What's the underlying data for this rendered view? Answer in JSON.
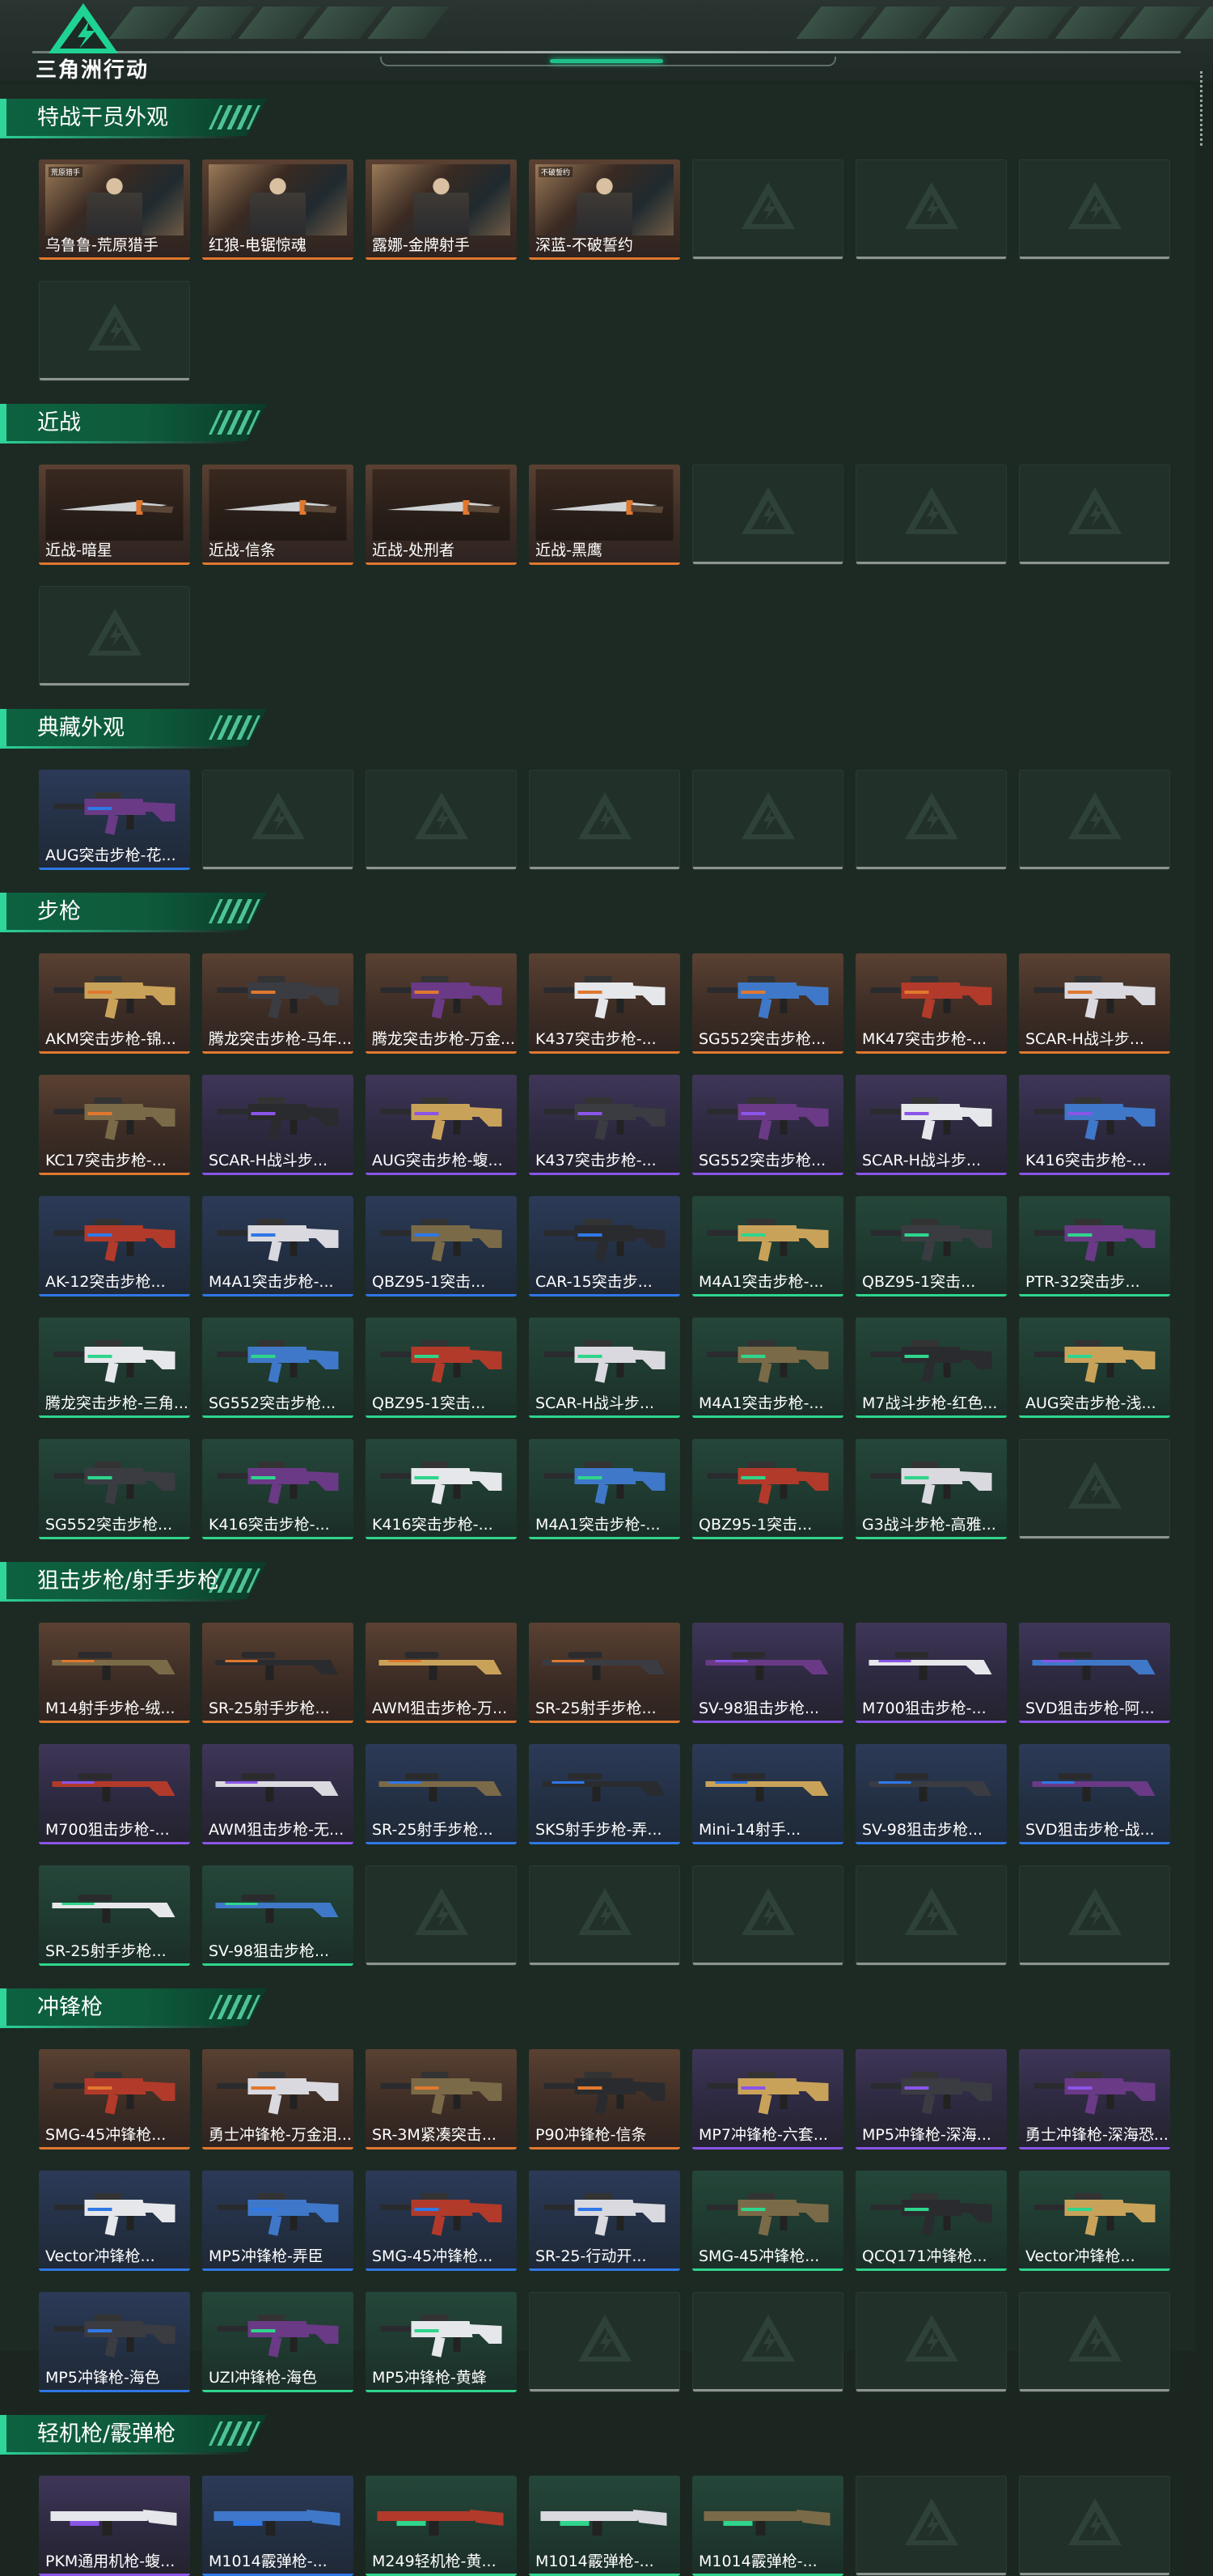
{
  "brand": {
    "name": "三角洲行动"
  },
  "colors": {
    "orange": "#e0782f",
    "purple": "#8a55e8",
    "blue": "#2f78e6",
    "green": "#2fd58c",
    "accent": "#2bd39a"
  },
  "sections": [
    {
      "title": "特战干员外观",
      "items": [
        {
          "name": "乌鲁鲁-荒原猎手",
          "quality": "orange",
          "icon": "operator-skin",
          "tag": "荒原猎手"
        },
        {
          "name": "红狼-电锯惊魂",
          "quality": "orange",
          "icon": "operator-skin"
        },
        {
          "name": "露娜-金牌射手",
          "quality": "orange",
          "icon": "operator-skin"
        },
        {
          "name": "深蓝-不破誓约",
          "quality": "orange",
          "icon": "operator-skin",
          "tag": "不破誓约"
        }
      ],
      "empty": 4
    },
    {
      "title": "近战",
      "items": [
        {
          "name": "近战-暗星",
          "quality": "orange",
          "icon": "knife"
        },
        {
          "name": "近战-信条",
          "quality": "orange",
          "icon": "karambit"
        },
        {
          "name": "近战-处刑者",
          "quality": "orange",
          "icon": "serrated-knife"
        },
        {
          "name": "近战-黑鹰",
          "quality": "orange",
          "icon": "knife"
        }
      ],
      "empty": 4
    },
    {
      "title": "典藏外观",
      "items": [
        {
          "name": "AUG突击步枪-花...",
          "quality": "blue",
          "icon": "rifle"
        }
      ],
      "empty": 6
    },
    {
      "title": "步枪",
      "items": [
        {
          "name": "AKM突击步枪-锦...",
          "quality": "orange",
          "icon": "rifle"
        },
        {
          "name": "腾龙突击步枪-马年...",
          "quality": "orange",
          "icon": "rifle"
        },
        {
          "name": "腾龙突击步枪-万金...",
          "quality": "orange",
          "icon": "rifle"
        },
        {
          "name": "K437突击步枪-...",
          "quality": "orange",
          "icon": "rifle"
        },
        {
          "name": "SG552突击步枪...",
          "quality": "orange",
          "icon": "rifle"
        },
        {
          "name": "MK47突击步枪-...",
          "quality": "orange",
          "icon": "rifle"
        },
        {
          "name": "SCAR-H战斗步...",
          "quality": "orange",
          "icon": "rifle"
        },
        {
          "name": "KC17突击步枪-...",
          "quality": "orange",
          "icon": "rifle"
        },
        {
          "name": "SCAR-H战斗步...",
          "quality": "purple",
          "icon": "rifle"
        },
        {
          "name": "AUG突击步枪-蝮...",
          "quality": "purple",
          "icon": "rifle"
        },
        {
          "name": "K437突击步枪-...",
          "quality": "purple",
          "icon": "rifle"
        },
        {
          "name": "SG552突击步枪...",
          "quality": "purple",
          "icon": "rifle"
        },
        {
          "name": "SCAR-H战斗步...",
          "quality": "purple",
          "icon": "rifle"
        },
        {
          "name": "K416突击步枪-...",
          "quality": "purple",
          "icon": "rifle"
        },
        {
          "name": "AK-12突击步枪...",
          "quality": "blue",
          "icon": "rifle"
        },
        {
          "name": "M4A1突击步枪-...",
          "quality": "blue",
          "icon": "rifle"
        },
        {
          "name": "QBZ95-1突击...",
          "quality": "blue",
          "icon": "rifle"
        },
        {
          "name": "CAR-15突击步...",
          "quality": "blue",
          "icon": "rifle"
        },
        {
          "name": "M4A1突击步枪-...",
          "quality": "green",
          "icon": "rifle"
        },
        {
          "name": "QBZ95-1突击...",
          "quality": "green",
          "icon": "rifle"
        },
        {
          "name": "PTR-32突击步...",
          "quality": "green",
          "icon": "rifle"
        },
        {
          "name": "腾龙突击步枪-三角...",
          "quality": "green",
          "icon": "rifle"
        },
        {
          "name": "SG552突击步枪...",
          "quality": "green",
          "icon": "rifle"
        },
        {
          "name": "QBZ95-1突击...",
          "quality": "green",
          "icon": "rifle"
        },
        {
          "name": "SCAR-H战斗步...",
          "quality": "green",
          "icon": "rifle"
        },
        {
          "name": "M4A1突击步枪-...",
          "quality": "green",
          "icon": "rifle"
        },
        {
          "name": "M7战斗步枪-红色...",
          "quality": "green",
          "icon": "rifle"
        },
        {
          "name": "AUG突击步枪-浅...",
          "quality": "green",
          "icon": "rifle"
        },
        {
          "name": "SG552突击步枪...",
          "quality": "green",
          "icon": "rifle"
        },
        {
          "name": "K416突击步枪-...",
          "quality": "green",
          "icon": "rifle"
        },
        {
          "name": "K416突击步枪-...",
          "quality": "green",
          "icon": "rifle"
        },
        {
          "name": "M4A1突击步枪-...",
          "quality": "green",
          "icon": "rifle"
        },
        {
          "name": "QBZ95-1突击...",
          "quality": "green",
          "icon": "rifle"
        },
        {
          "name": "G3战斗步枪-高雅...",
          "quality": "green",
          "icon": "rifle"
        }
      ],
      "empty": 1
    },
    {
      "title": "狙击步枪/射手步枪",
      "items": [
        {
          "name": "M14射手步枪-绒...",
          "quality": "orange",
          "icon": "sniper"
        },
        {
          "name": "SR-25射手步枪...",
          "quality": "orange",
          "icon": "sniper"
        },
        {
          "name": "AWM狙击步枪-万...",
          "quality": "orange",
          "icon": "sniper"
        },
        {
          "name": "SR-25射手步枪...",
          "quality": "orange",
          "icon": "sniper"
        },
        {
          "name": "SV-98狙击步枪...",
          "quality": "purple",
          "icon": "sniper"
        },
        {
          "name": "M700狙击步枪-...",
          "quality": "purple",
          "icon": "sniper"
        },
        {
          "name": "SVD狙击步枪-阿...",
          "quality": "purple",
          "icon": "sniper"
        },
        {
          "name": "M700狙击步枪-...",
          "quality": "purple",
          "icon": "sniper"
        },
        {
          "name": "AWM狙击步枪-无...",
          "quality": "purple",
          "icon": "sniper"
        },
        {
          "name": "SR-25射手步枪...",
          "quality": "blue",
          "icon": "sniper"
        },
        {
          "name": "SKS射手步枪-弄...",
          "quality": "blue",
          "icon": "sniper"
        },
        {
          "name": "Mini-14射手...",
          "quality": "blue",
          "icon": "sniper"
        },
        {
          "name": "SV-98狙击步枪...",
          "quality": "blue",
          "icon": "sniper"
        },
        {
          "name": "SVD狙击步枪-战...",
          "quality": "blue",
          "icon": "sniper"
        },
        {
          "name": "SR-25射手步枪...",
          "quality": "green",
          "icon": "sniper"
        },
        {
          "name": "SV-98狙击步枪...",
          "quality": "green",
          "icon": "sniper"
        }
      ],
      "empty": 5
    },
    {
      "title": "冲锋枪",
      "items": [
        {
          "name": "SMG-45冲锋枪...",
          "quality": "orange",
          "icon": "smg"
        },
        {
          "name": "勇士冲锋枪-万金泪...",
          "quality": "orange",
          "icon": "smg"
        },
        {
          "name": "SR-3M紧凑突击...",
          "quality": "orange",
          "icon": "smg"
        },
        {
          "name": "P90冲锋枪-信条",
          "quality": "orange",
          "icon": "smg"
        },
        {
          "name": "MP7冲锋枪-六套...",
          "quality": "purple",
          "icon": "smg"
        },
        {
          "name": "MP5冲锋枪-深海...",
          "quality": "purple",
          "icon": "smg"
        },
        {
          "name": "勇士冲锋枪-深海恐...",
          "quality": "purple",
          "icon": "smg"
        },
        {
          "name": "Vector冲锋枪...",
          "quality": "blue",
          "icon": "smg"
        },
        {
          "name": "MP5冲锋枪-弄臣",
          "quality": "blue",
          "icon": "smg"
        },
        {
          "name": "SMG-45冲锋枪...",
          "quality": "blue",
          "icon": "smg"
        },
        {
          "name": "SR-25-行动开...",
          "quality": "blue",
          "icon": "smg"
        },
        {
          "name": "SMG-45冲锋枪...",
          "quality": "green",
          "icon": "smg"
        },
        {
          "name": "QCQ171冲锋枪...",
          "quality": "green",
          "icon": "smg"
        },
        {
          "name": "Vector冲锋枪...",
          "quality": "green",
          "icon": "smg"
        },
        {
          "name": "MP5冲锋枪-海色",
          "quality": "blue",
          "icon": "smg"
        },
        {
          "name": "UZI冲锋枪-海色",
          "quality": "green",
          "icon": "smg"
        },
        {
          "name": "MP5冲锋枪-黄蜂",
          "quality": "green",
          "icon": "smg"
        }
      ],
      "empty": 4
    },
    {
      "title": "轻机枪/霰弹枪",
      "items": [
        {
          "name": "PKM通用机枪-蝮...",
          "quality": "purple",
          "icon": "machine-gun"
        },
        {
          "name": "M1014霰弹枪-...",
          "quality": "blue",
          "icon": "shotgun"
        },
        {
          "name": "M249轻机枪-黄...",
          "quality": "green",
          "icon": "machine-gun"
        },
        {
          "name": "M1014霰弹枪-...",
          "quality": "green",
          "icon": "shotgun"
        },
        {
          "name": "M1014霰弹枪-...",
          "quality": "green",
          "icon": "shotgun"
        }
      ],
      "empty": 2
    }
  ]
}
